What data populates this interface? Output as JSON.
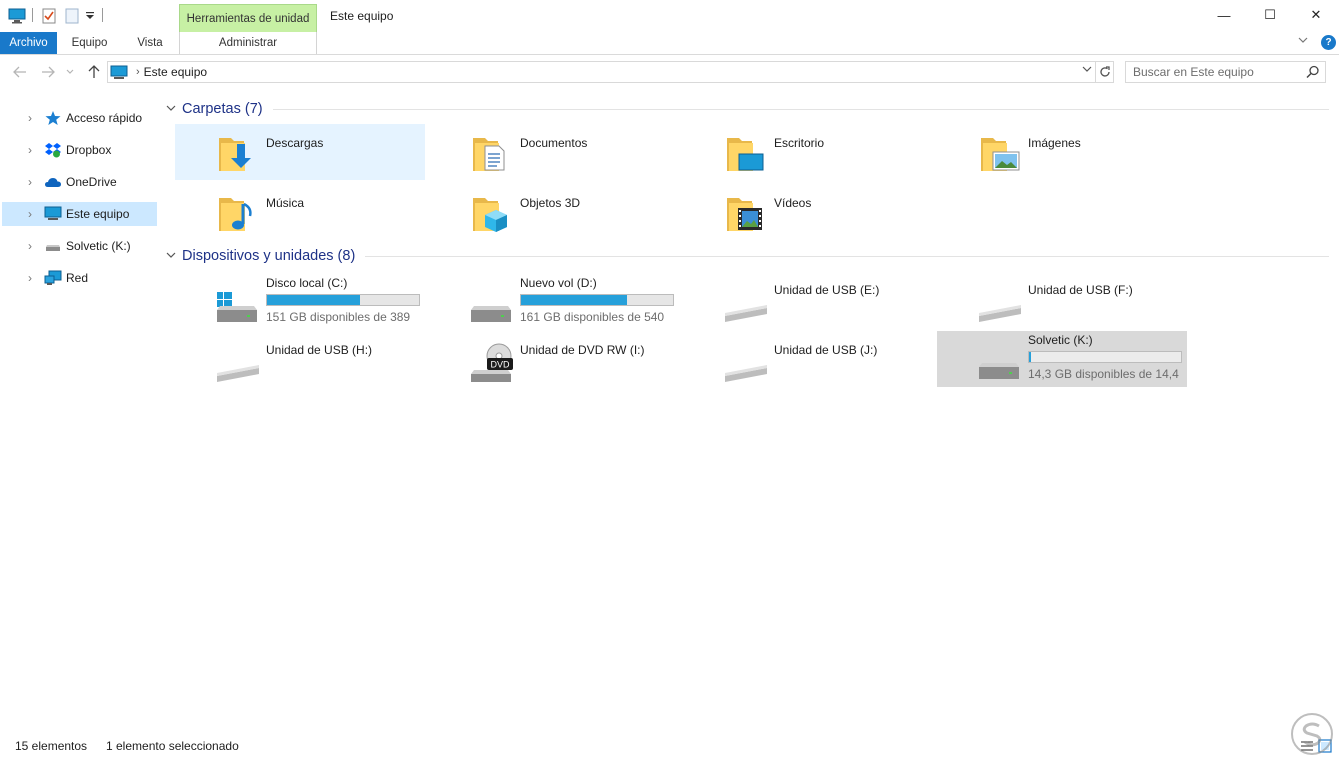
{
  "window": {
    "title": "Este equipo",
    "contextual_tab": "Herramientas de unidad",
    "minimize_glyph": "—",
    "maximize_glyph": "☐",
    "close_glyph": "✕"
  },
  "ribbon": {
    "tabs": [
      {
        "label": "Archivo",
        "active": true
      },
      {
        "label": "Equipo"
      },
      {
        "label": "Vista"
      },
      {
        "label": "Administrar"
      }
    ],
    "help_label": "?"
  },
  "address": {
    "path": "Este equipo",
    "separator": "›",
    "search_placeholder": "Buscar en Este equipo"
  },
  "navpane": {
    "items": [
      {
        "label": "Acceso rápido",
        "icon": "star-icon"
      },
      {
        "label": "Dropbox",
        "icon": "dropbox-icon"
      },
      {
        "label": "OneDrive",
        "icon": "cloud-icon"
      },
      {
        "label": "Este equipo",
        "icon": "computer-icon",
        "selected": true
      },
      {
        "label": "Solvetic (K:)",
        "icon": "usb-drive-icon"
      },
      {
        "label": "Red",
        "icon": "network-icon"
      }
    ]
  },
  "groups": {
    "folders": {
      "title": "Carpetas (7)",
      "items": [
        {
          "name": "Descargas",
          "icon": "downloads-folder-icon",
          "selected": true
        },
        {
          "name": "Documentos",
          "icon": "documents-folder-icon"
        },
        {
          "name": "Escritorio",
          "icon": "desktop-folder-icon"
        },
        {
          "name": "Imágenes",
          "icon": "pictures-folder-icon"
        },
        {
          "name": "Música",
          "icon": "music-folder-icon"
        },
        {
          "name": "Objetos 3D",
          "icon": "3d-objects-folder-icon"
        },
        {
          "name": "Vídeos",
          "icon": "videos-folder-icon"
        }
      ]
    },
    "devices": {
      "title": "Dispositivos y unidades (8)",
      "items": [
        {
          "name": "Disco local (C:)",
          "free": "151 GB disponibles de 389",
          "used_fraction": 0.61,
          "icon": "windows-drive-icon"
        },
        {
          "name": "Nuevo vol (D:)",
          "free": "161 GB disponibles de 540",
          "used_fraction": 0.7,
          "icon": "hard-drive-icon"
        },
        {
          "name": "Unidad de USB (E:)",
          "icon": "usb-drive-icon"
        },
        {
          "name": "Unidad de USB (F:)",
          "icon": "usb-drive-icon"
        },
        {
          "name": "Unidad de USB (H:)",
          "icon": "usb-drive-icon"
        },
        {
          "name": "Unidad de DVD RW (I:)",
          "icon": "dvd-drive-icon",
          "badge": "DVD"
        },
        {
          "name": "Unidad de USB (J:)",
          "icon": "usb-drive-icon"
        },
        {
          "name": "Solvetic (K:)",
          "free": "14,3 GB disponibles de 14,4",
          "used_fraction": 0.01,
          "icon": "hard-drive-icon",
          "selected": true
        }
      ]
    }
  },
  "status": {
    "count": "15 elementos",
    "selection": "1 elemento seleccionado"
  },
  "colors": {
    "accent": "#1979ca",
    "bar_fill": "#26a0da",
    "selection": "#cce8ff",
    "group_title": "#1e3287",
    "contextual_tab": "#c7f0a4"
  }
}
